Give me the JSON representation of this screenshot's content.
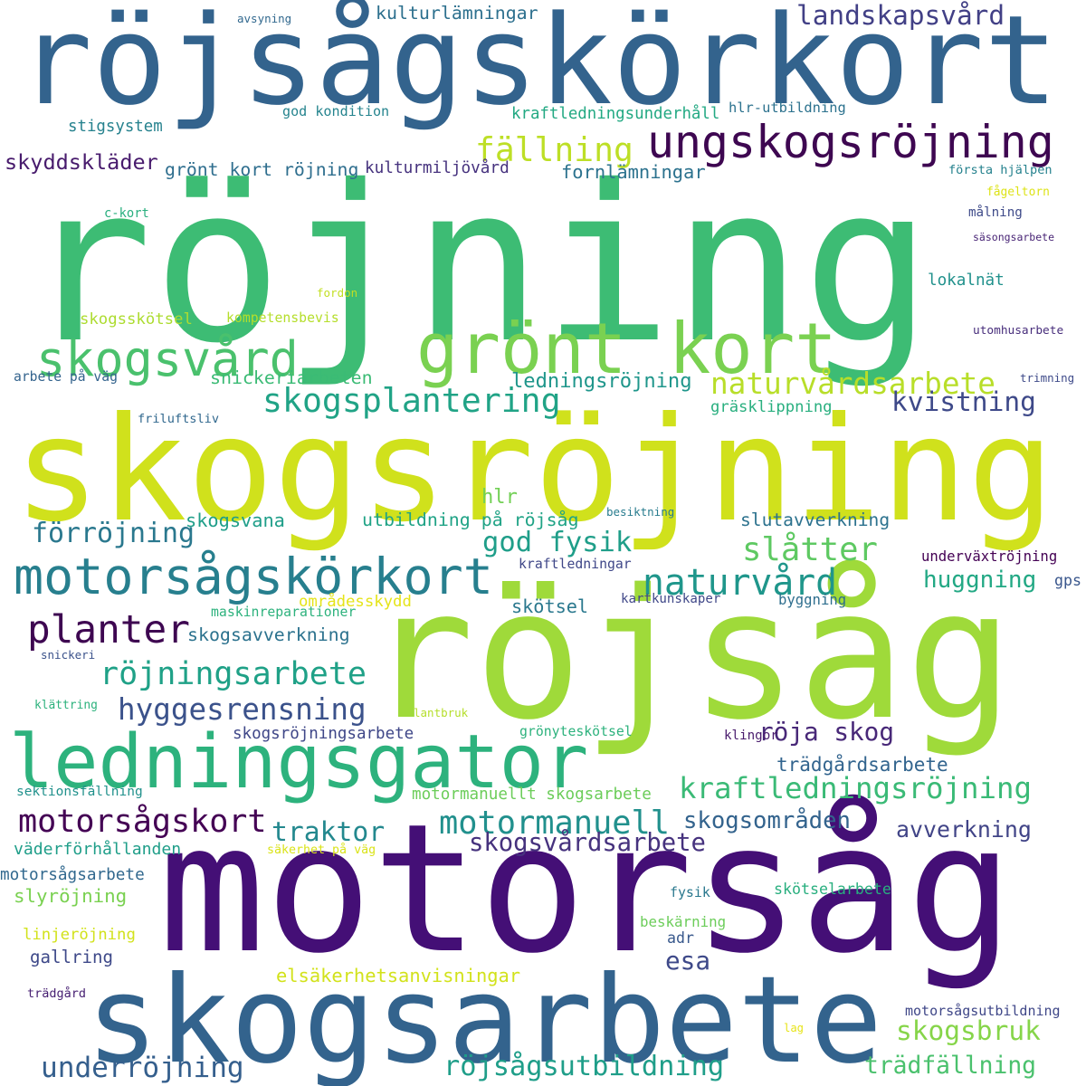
{
  "colors": {
    "background": "#ffffff",
    "palette": [
      "#440154",
      "#482878",
      "#3e4989",
      "#31688e",
      "#26828e",
      "#1f9e89",
      "#35b779",
      "#6ece58",
      "#b5de2b",
      "#d8e219",
      "#fde725"
    ]
  },
  "words": [
    {
      "text": "röjning",
      "color": "#3dbc74"
    },
    {
      "text": "röjsågskörkort",
      "color": "#33638d"
    },
    {
      "text": "skogsröjning",
      "color": "#d0e11c"
    },
    {
      "text": "röjsåg",
      "color": "#9fda3a"
    },
    {
      "text": "motorsåg",
      "color": "#440f76"
    },
    {
      "text": "skogsarbete",
      "color": "#33638d"
    },
    {
      "text": "grönt kort",
      "color": "#7ad151"
    },
    {
      "text": "ledningsgator",
      "color": "#2db27d"
    },
    {
      "text": "ungskogsröjning",
      "color": "#3e0751"
    },
    {
      "text": "motorsågskörkort",
      "color": "#277f8e"
    },
    {
      "text": "skogsvård",
      "color": "#4ac16d"
    },
    {
      "text": "planter",
      "color": "#3e0751"
    },
    {
      "text": "röjningsarbete",
      "color": "#1fa187"
    },
    {
      "text": "hyggesrensning",
      "color": "#3b528b"
    },
    {
      "text": "motorsågskort",
      "color": "#440154"
    },
    {
      "text": "fällning",
      "color": "#bddf26"
    },
    {
      "text": "skogsplantering",
      "color": "#20a386"
    },
    {
      "text": "naturvårdsarbete",
      "color": "#b8de29"
    },
    {
      "text": "kvistning",
      "color": "#3e4989"
    },
    {
      "text": "landskapsvård",
      "color": "#424086"
    },
    {
      "text": "förröjning",
      "color": "#2a788e"
    },
    {
      "text": "god fysik",
      "color": "#1f9e89"
    },
    {
      "text": "slåtter",
      "color": "#5ec962"
    },
    {
      "text": "naturvård",
      "color": "#1f968b"
    },
    {
      "text": "huggning",
      "color": "#22a884"
    },
    {
      "text": "röja skog",
      "color": "#482878"
    },
    {
      "text": "kraftledningsröjning",
      "color": "#3aba76"
    },
    {
      "text": "motormanuell",
      "color": "#21908d"
    },
    {
      "text": "traktor",
      "color": "#23888e"
    },
    {
      "text": "avverkning",
      "color": "#414487"
    },
    {
      "text": "skogsvårdsarbete",
      "color": "#46327e"
    },
    {
      "text": "esa",
      "color": "#3e4989"
    },
    {
      "text": "skogsbruk",
      "color": "#86d549"
    },
    {
      "text": "gallring",
      "color": "#3e4989"
    },
    {
      "text": "underröjning",
      "color": "#355f8d"
    },
    {
      "text": "röjsågsutbildning",
      "color": "#1f9e89"
    },
    {
      "text": "trädfällning",
      "color": "#4ac16d"
    },
    {
      "text": "skyddskläder",
      "color": "#481b6d"
    },
    {
      "text": "grönt kort röjning",
      "color": "#2e6e8e"
    },
    {
      "text": "kulturmiljövård",
      "color": "#46327e"
    },
    {
      "text": "fornlämningar",
      "color": "#2c728e"
    },
    {
      "text": "första hjälpen",
      "color": "#26828e"
    },
    {
      "text": "kulturlämningar",
      "color": "#2d708e"
    },
    {
      "text": "stigsystem",
      "color": "#26828e"
    },
    {
      "text": "god kondition",
      "color": "#25848e"
    },
    {
      "text": "kraftledningsunderhåll",
      "color": "#23a983"
    },
    {
      "text": "hlr-utbildning",
      "color": "#2c728e"
    },
    {
      "text": "avsyning",
      "color": "#31688e"
    },
    {
      "text": "c-kort",
      "color": "#29af7f"
    },
    {
      "text": "fågeltorn",
      "color": "#dde318"
    },
    {
      "text": "målning",
      "color": "#3e4a89"
    },
    {
      "text": "säsongsarbete",
      "color": "#482475"
    },
    {
      "text": "lokalnät",
      "color": "#21918c"
    },
    {
      "text": "fordon",
      "color": "#c2df23"
    },
    {
      "text": "skogsskötsel",
      "color": "#addc30"
    },
    {
      "text": "kompetensbevis",
      "color": "#b5de2b"
    },
    {
      "text": "utomhusarbete",
      "color": "#472d7b"
    },
    {
      "text": "arbete på väg",
      "color": "#33638d"
    },
    {
      "text": "snickeriarbeten",
      "color": "#3bbb75"
    },
    {
      "text": "ledningsröjning",
      "color": "#1f968b"
    },
    {
      "text": "gräsklippning",
      "color": "#29af7f"
    },
    {
      "text": "trimning",
      "color": "#3e4a89"
    },
    {
      "text": "friluftsliv",
      "color": "#31688e"
    },
    {
      "text": "hlr",
      "color": "#73d056"
    },
    {
      "text": "skogsvana",
      "color": "#1f9e89"
    },
    {
      "text": "utbildning på röjsåg",
      "color": "#20a386"
    },
    {
      "text": "besiktning",
      "color": "#287c8e"
    },
    {
      "text": "slutavverkning",
      "color": "#2c728e"
    },
    {
      "text": "underväxtröjning",
      "color": "#440154"
    },
    {
      "text": "kraftledningar",
      "color": "#3f4788"
    },
    {
      "text": "gps",
      "color": "#39568c"
    },
    {
      "text": "områdesskydd",
      "color": "#e5e419"
    },
    {
      "text": "skötsel",
      "color": "#2a788e"
    },
    {
      "text": "kartkunskaper",
      "color": "#3f4788"
    },
    {
      "text": "byggning",
      "color": "#2e6e8e"
    },
    {
      "text": "maskinreparationer",
      "color": "#2db27d"
    },
    {
      "text": "skogsavverkning",
      "color": "#2c728e"
    },
    {
      "text": "snickeri",
      "color": "#3b528b"
    },
    {
      "text": "klättring",
      "color": "#2db27d"
    },
    {
      "text": "lantbruk",
      "color": "#b5de2b"
    },
    {
      "text": "skogsröjningsarbete",
      "color": "#3f4788"
    },
    {
      "text": "grönyteskötsel",
      "color": "#2db27d"
    },
    {
      "text": "klingor",
      "color": "#481a6c"
    },
    {
      "text": "trädgårdsarbete",
      "color": "#32648e"
    },
    {
      "text": "sektionsfällning",
      "color": "#21918c"
    },
    {
      "text": "motormanuellt skogsarbete",
      "color": "#6ccd5a"
    },
    {
      "text": "skogsområden",
      "color": "#33638d"
    },
    {
      "text": "väderförhållanden",
      "color": "#1f9e89"
    },
    {
      "text": "säkerhet på väg",
      "color": "#dae319"
    },
    {
      "text": "motorsågsarbete",
      "color": "#31688e"
    },
    {
      "text": "slyröjning",
      "color": "#7ad151"
    },
    {
      "text": "fysik",
      "color": "#2a788e"
    },
    {
      "text": "skötselarbete",
      "color": "#29af7f"
    },
    {
      "text": "linjeröjning",
      "color": "#d2e21b"
    },
    {
      "text": "beskärning",
      "color": "#6ccd5a"
    },
    {
      "text": "adr",
      "color": "#38588c"
    },
    {
      "text": "elsäkerhetsanvisningar",
      "color": "#d2e21b"
    },
    {
      "text": "trädgård",
      "color": "#482173"
    },
    {
      "text": "motorsågsutbildning",
      "color": "#3f4788"
    },
    {
      "text": "lag",
      "color": "#e7e419"
    }
  ]
}
